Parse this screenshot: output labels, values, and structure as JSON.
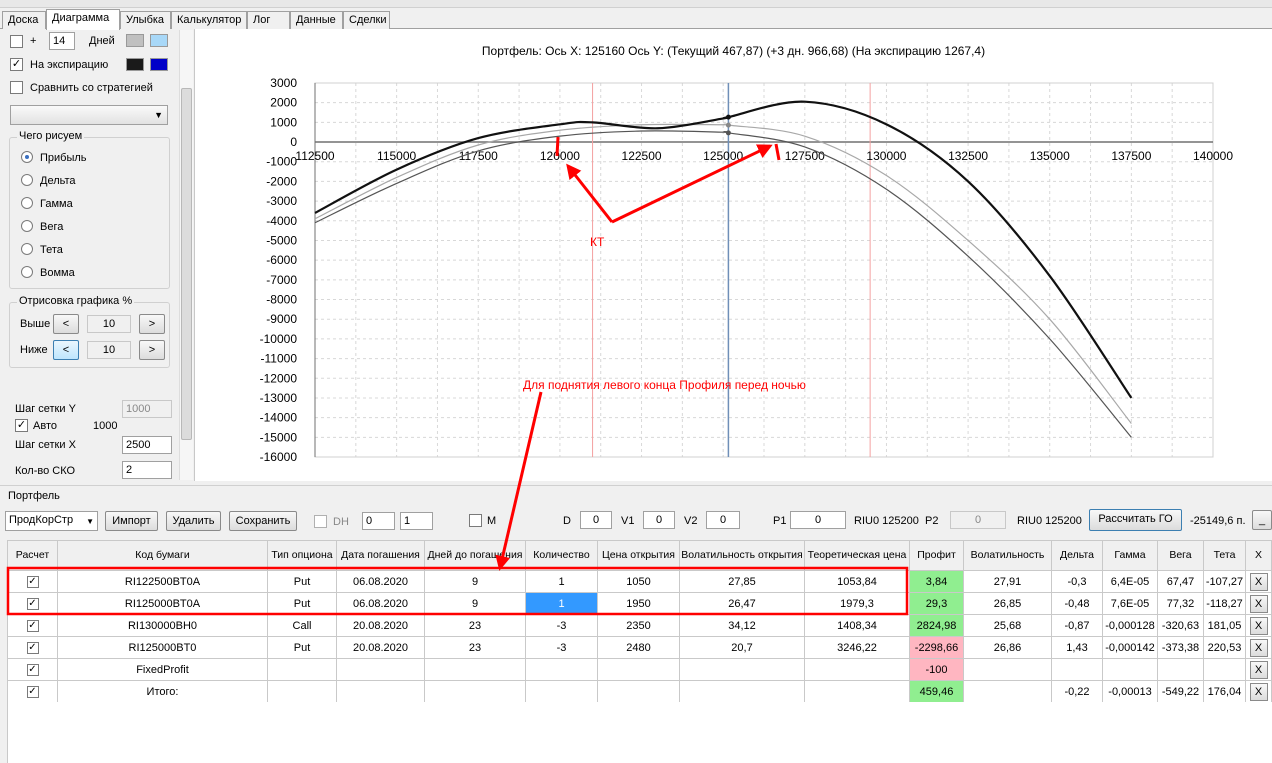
{
  "tabs": [
    "Доска",
    "Диаграмма",
    "Улыбка",
    "Калькулятор",
    "Лог",
    "Данные",
    "Сделки"
  ],
  "left": {
    "plus_label": "+",
    "days_value": "14",
    "days_label": "Дней",
    "expiry_label": "На экспирацию",
    "compare_label": "Сравнить со стратегией",
    "what_group": "Чего рисуем",
    "radios": [
      "Прибыль",
      "Дельта",
      "Гамма",
      "Вега",
      "Тета",
      "Вомма"
    ],
    "draw_group": "Отрисовка графика %",
    "above_label": "Выше",
    "above_value": "10",
    "below_label": "Ниже",
    "below_value": "10",
    "lt": "<",
    "gt": ">",
    "gridy_label": "Шаг сетки Y",
    "gridy_value": "1000",
    "auto_label": "Авто",
    "auto_value": "1000",
    "gridx_label": "Шаг сетки X",
    "gridx_value": "2500",
    "sko_label": "Кол-во СКО",
    "sko_value": "2",
    "colors": {
      "swatch1": "#c0c0c0",
      "swatch2": "#a8d8f8",
      "swatch3": "#1a1a1a",
      "swatch4": "#0000c8"
    }
  },
  "chart_title": "Портфель: Ось X: 125160 Ось Y:  (Текущий 467,87)  (+3 дн. 966,68)  (На экспирацию  1267,4)",
  "annotations": {
    "kt": "КТ",
    "note": "Для поднятия левого конца Профиля перед ночью"
  },
  "chart_data": {
    "type": "line",
    "xlim": [
      112500,
      140000
    ],
    "ylim": [
      -16000,
      3000
    ],
    "xticks": [
      112500,
      115000,
      117500,
      120000,
      122500,
      125000,
      127500,
      130000,
      132500,
      135000,
      137500,
      140000
    ],
    "yticks": [
      3000,
      2000,
      1000,
      0,
      -1000,
      -2000,
      -3000,
      -4000,
      -5000,
      -6000,
      -7000,
      -8000,
      -9000,
      -10000,
      -11000,
      -12000,
      -13000,
      -14000,
      -15000,
      -16000
    ],
    "grid": true,
    "current_x": 125160,
    "vlines": [
      121000,
      129500
    ],
    "series": [
      {
        "color": "#111111",
        "width": 2.2,
        "points": [
          [
            112500,
            -3600
          ],
          [
            115000,
            -1400
          ],
          [
            117500,
            200
          ],
          [
            120000,
            900
          ],
          [
            121000,
            1000
          ],
          [
            123000,
            700
          ],
          [
            125000,
            1200
          ],
          [
            125160,
            1267
          ],
          [
            127500,
            2050
          ],
          [
            130000,
            900
          ],
          [
            132500,
            -2000
          ],
          [
            135000,
            -6800
          ],
          [
            137500,
            -13000
          ]
        ]
      },
      {
        "color": "#a8a8a8",
        "width": 1.2,
        "points": [
          [
            112500,
            -3900
          ],
          [
            115000,
            -1800
          ],
          [
            117500,
            -150
          ],
          [
            120000,
            600
          ],
          [
            122500,
            880
          ],
          [
            125000,
            880
          ],
          [
            125160,
            860
          ],
          [
            127500,
            300
          ],
          [
            130000,
            -1700
          ],
          [
            132500,
            -5000
          ],
          [
            135000,
            -9000
          ],
          [
            137500,
            -14300
          ]
        ]
      },
      {
        "color": "#555555",
        "width": 1.2,
        "points": [
          [
            112500,
            -4100
          ],
          [
            115000,
            -2100
          ],
          [
            117500,
            -450
          ],
          [
            120000,
            300
          ],
          [
            122500,
            560
          ],
          [
            125000,
            500
          ],
          [
            125160,
            468
          ],
          [
            127500,
            -250
          ],
          [
            130000,
            -2400
          ],
          [
            132500,
            -5800
          ],
          [
            135000,
            -10000
          ],
          [
            137500,
            -15000
          ]
        ]
      }
    ]
  },
  "portfolio": {
    "group_label": "Портфель",
    "strategy": "ПродКорСтр",
    "import": "Импорт",
    "delete": "Удалить",
    "save": "Сохранить",
    "dh": "DH",
    "spin1": "0",
    "spin2": "1",
    "m": "M",
    "d_label": "D",
    "d_value": "0",
    "v1_label": "V1",
    "v1_value": "0",
    "v2_label": "V2",
    "v2_value": "0",
    "p1_label": "P1",
    "p1_value": "0",
    "riu1": "RIU0 125200",
    "p2_label": "P2",
    "p2_value": "0",
    "riu2": "RIU0 125200",
    "calc_go": "Рассчитать ГО",
    "go_value": "-25149,6 п.",
    "minimize": "_"
  },
  "table": {
    "headers": [
      "Расчет",
      "Код бумаги",
      "Тип опциона",
      "Дата погашения",
      "Дней до погашения",
      "Количество",
      "Цена открытия",
      "Волатильность открытия",
      "Теоретическая цена",
      "Профит",
      "Волатильность",
      "Дельта",
      "Гамма",
      "Вега",
      "Тета",
      "X"
    ],
    "rows": [
      [
        "RI122500BT0A",
        "Put",
        "06.08.2020",
        "9",
        "1",
        "1050",
        "27,85",
        "1053,84",
        "3,84",
        "27,91",
        "-0,3",
        "6,4E-05",
        "67,47",
        "-107,27"
      ],
      [
        "RI125000BT0A",
        "Put",
        "06.08.2020",
        "9",
        "1",
        "1950",
        "26,47",
        "1979,3",
        "29,3",
        "26,85",
        "-0,48",
        "7,6E-05",
        "77,32",
        "-118,27"
      ],
      [
        "RI130000BH0",
        "Call",
        "20.08.2020",
        "23",
        "-3",
        "2350",
        "34,12",
        "1408,34",
        "2824,98",
        "25,68",
        "-0,87",
        "-0,000128",
        "-320,63",
        "181,05"
      ],
      [
        "RI125000BT0",
        "Put",
        "20.08.2020",
        "23",
        "-3",
        "2480",
        "20,7",
        "3246,22",
        "-2298,66",
        "26,86",
        "1,43",
        "-0,000142",
        "-373,38",
        "220,53"
      ],
      [
        "FixedProfit",
        "",
        "",
        "",
        "",
        "",
        "",
        "",
        "-100",
        "",
        "",
        "",
        "",
        ""
      ],
      [
        "Итого:",
        "",
        "",
        "",
        "",
        "",
        "",
        "",
        "459,46",
        "",
        "-0,22",
        "-0,00013",
        "-549,22",
        "176,04"
      ]
    ],
    "x_label": "X",
    "check": "✓"
  }
}
